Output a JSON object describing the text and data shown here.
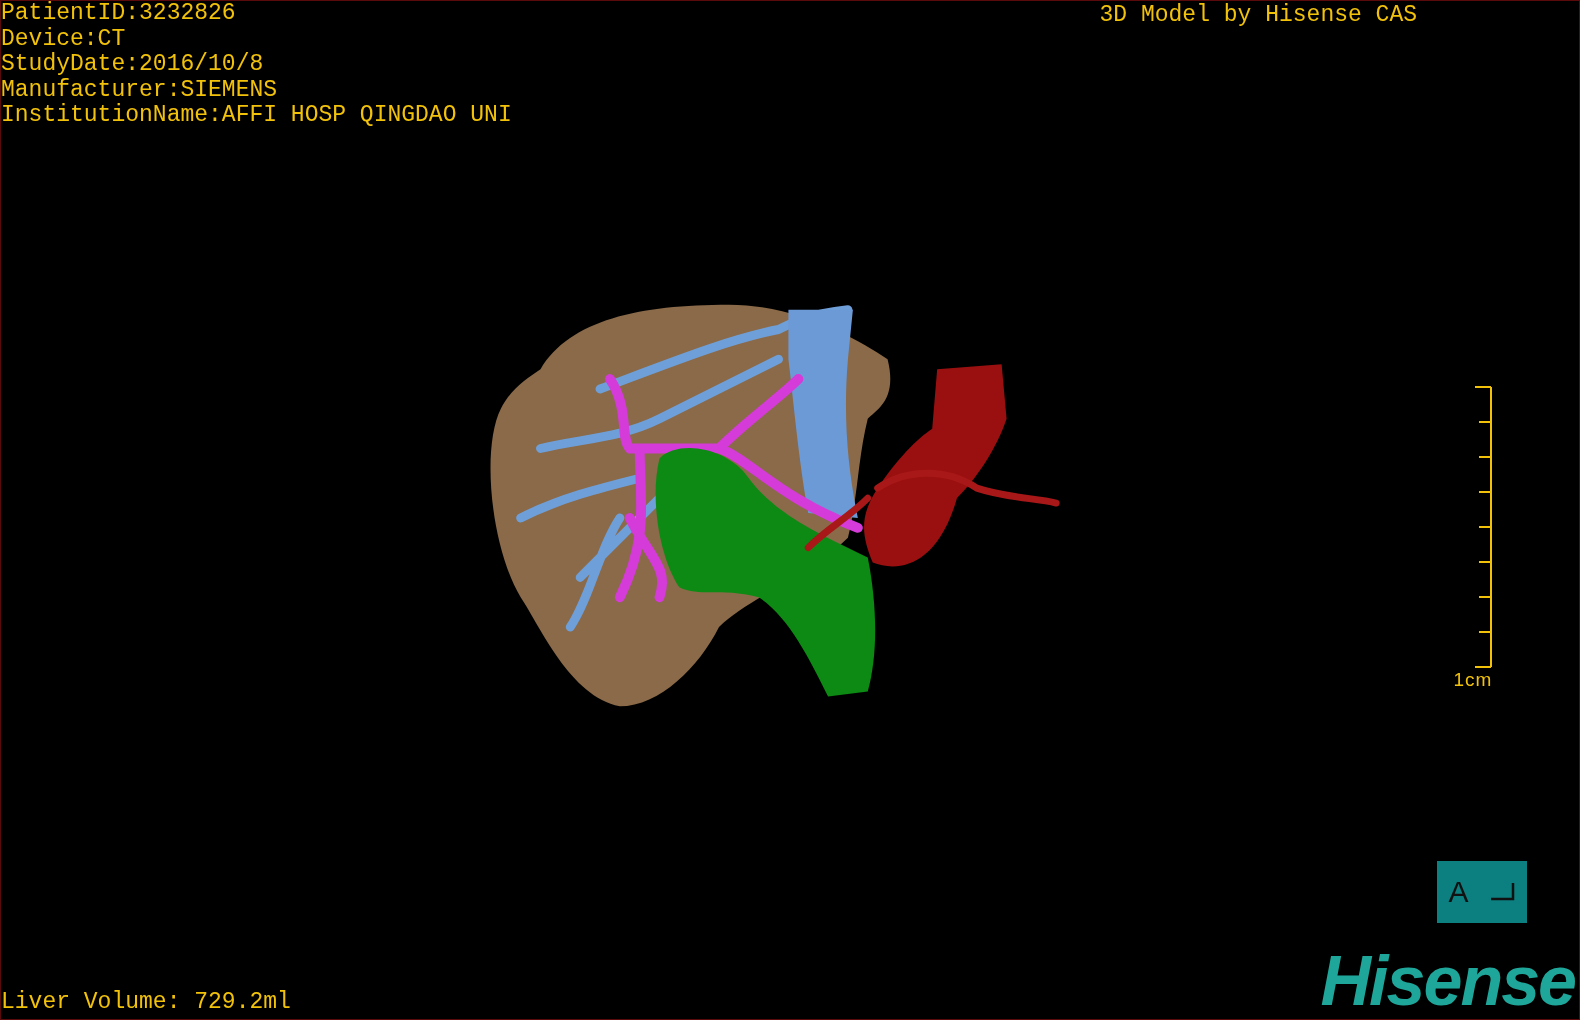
{
  "info_lines": [
    "PatientID:3232826",
    "Device:CT",
    "StudyDate:2016/10/8",
    "Manufacturer:SIEMENS",
    "InstitutionName:AFFI HOSP QINGDAO UNI"
  ],
  "title": "3D Model by Hisense CAS",
  "scale": {
    "label": "1cm"
  },
  "orientation": {
    "label": "A"
  },
  "logo": "Hisense",
  "volume": "Liver Volume: 729.2ml"
}
